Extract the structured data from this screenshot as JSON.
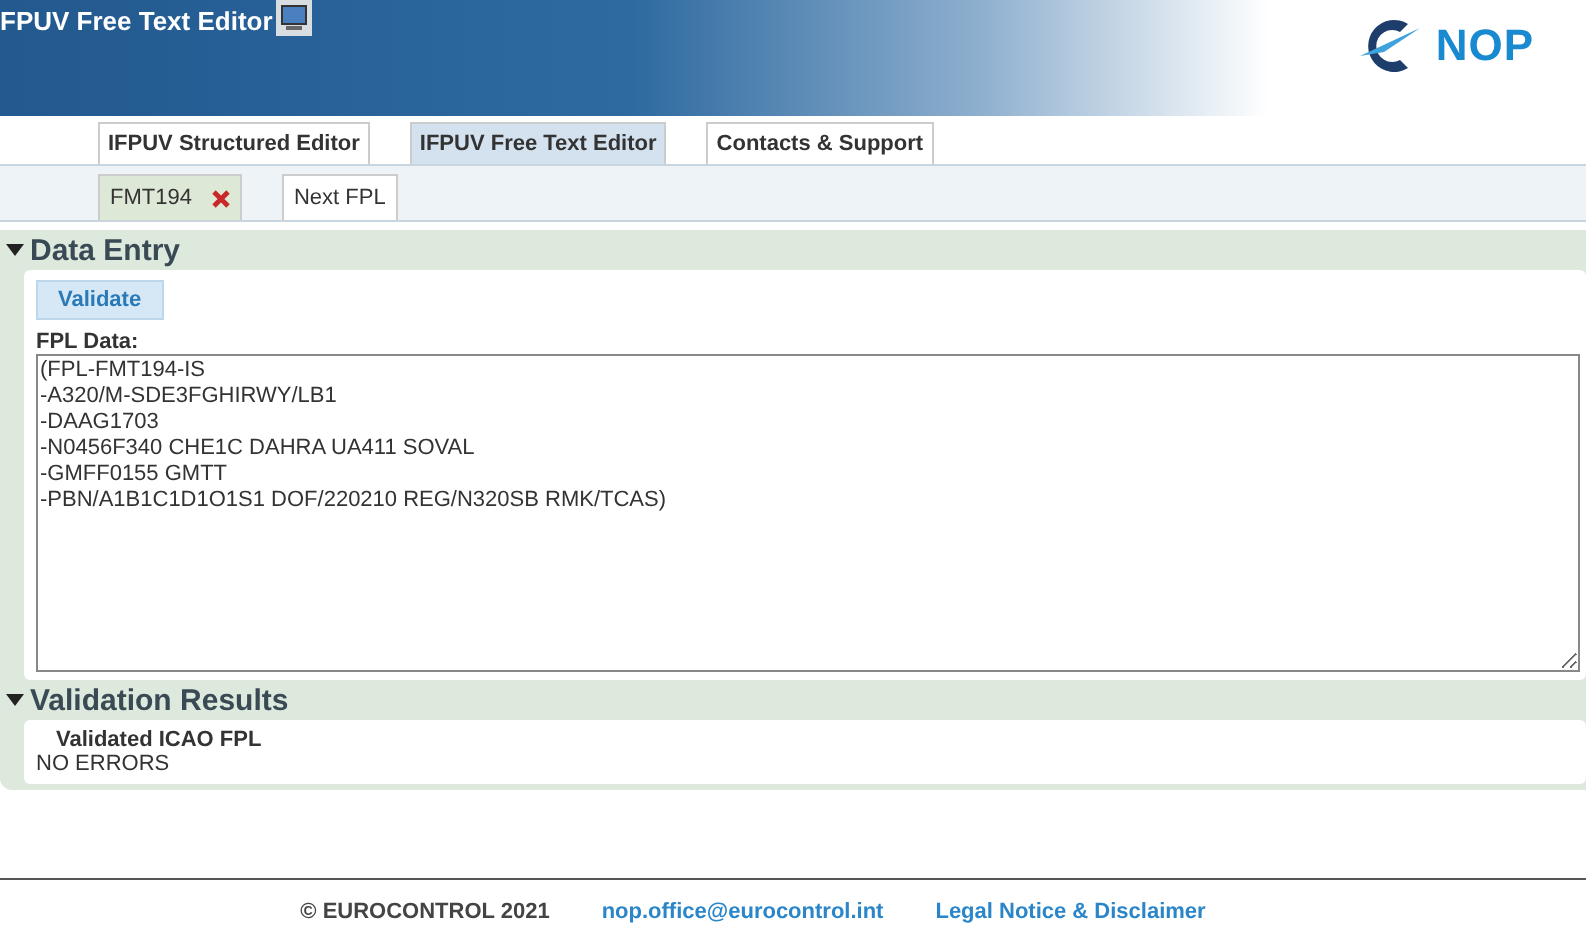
{
  "header": {
    "title": "FPUV Free Text Editor",
    "brand": "NOP"
  },
  "nav_tabs": [
    {
      "label": "IFPUV Structured Editor",
      "selected": false
    },
    {
      "label": "IFPUV Free Text Editor",
      "selected": true
    },
    {
      "label": "Contacts & Support",
      "selected": false
    }
  ],
  "doc_tabs": [
    {
      "label": "FMT194",
      "selected": true,
      "closable": true
    },
    {
      "label": "Next FPL",
      "selected": false,
      "closable": false
    }
  ],
  "data_entry": {
    "title": "Data Entry",
    "expanded": true,
    "validate_button": "Validate",
    "field_label": "FPL Data:",
    "fpl_lines": [
      "(FPL-FMT194-IS",
      "-A320/M-SDE3FGHIRWY/LB1",
      "-DAAG1703",
      "-N0456F340 CHE1C DAHRA UA411 SOVAL",
      "-GMFF0155 GMTT",
      "-PBN/A1B1C1D1O1S1 DOF/220210 REG/N320SB RMK/TCAS)"
    ]
  },
  "validation_results": {
    "title": "Validation Results",
    "expanded": true,
    "heading": "Validated ICAO FPL",
    "message": "NO ERRORS"
  },
  "footer": {
    "copyright": "© EUROCONTROL 2021",
    "email": "nop.office@eurocontrol.int",
    "legal": "Legal Notice & Disclaimer"
  }
}
